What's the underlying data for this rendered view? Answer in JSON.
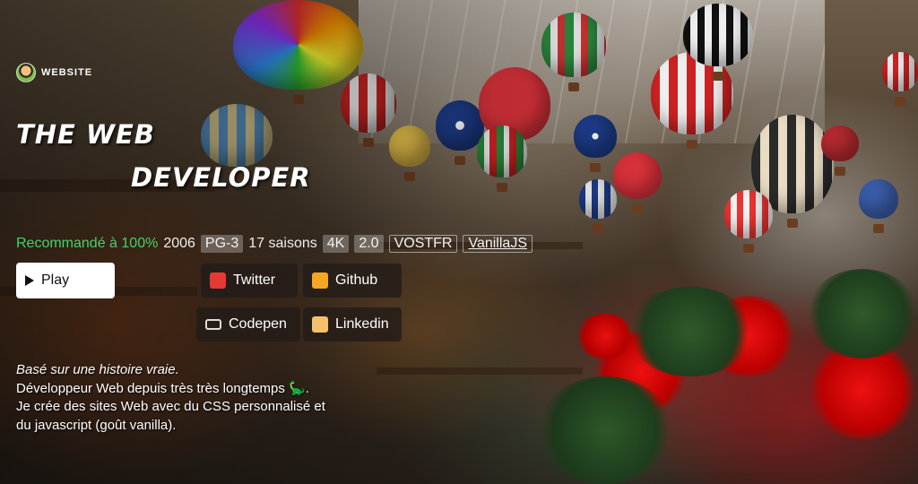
{
  "brand": {
    "label": "WEBSITE",
    "logo_icon": "developer-avatar-icon"
  },
  "title": {
    "line1": "THE WEB",
    "line2": "DEVELOPER"
  },
  "meta": {
    "recommendation": "Recommandé à 100%",
    "year": "2006",
    "rating": "PG-3",
    "seasons": "17 saisons",
    "badges": [
      "4K",
      "2.0",
      "VOSTFR",
      "VanillaJS"
    ]
  },
  "actions": {
    "play_label": "Play",
    "twitter_label": "Twitter",
    "github_label": "Github",
    "codepen_label": "Codepen",
    "linkedin_label": "Linkedin"
  },
  "description": {
    "line1": "Basé sur une histoire vraie.",
    "line2": "Développeur Web depuis très très longtemps 🦕.",
    "line3": "Je crée des sites Web avec du CSS personnalisé et",
    "line4": "du javascript (goût vanilla)."
  },
  "colors": {
    "recommendation": "#46d369",
    "play_bg": "#ffffff",
    "social_bg": "#231c18"
  }
}
